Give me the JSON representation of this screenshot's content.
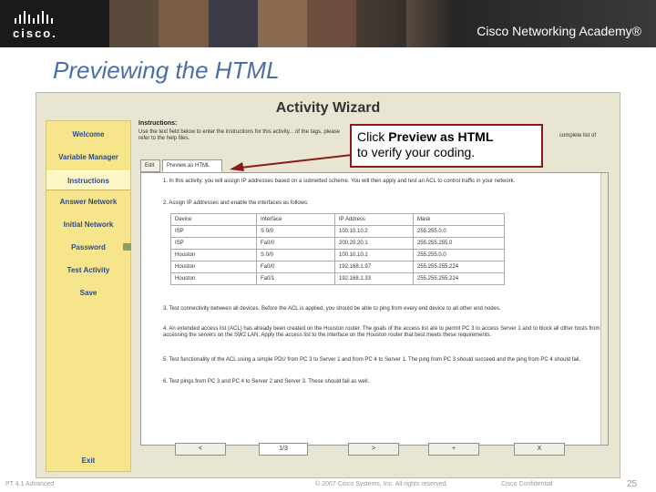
{
  "header": {
    "academy_text": "Cisco Networking Academy®",
    "logo_text": "cisco."
  },
  "slide": {
    "title": "Previewing the HTML"
  },
  "wizard": {
    "title": "Activity Wizard",
    "sidebar": [
      {
        "label": "Welcome"
      },
      {
        "label": "Variable Manager"
      },
      {
        "label": "Instructions"
      },
      {
        "label": "Answer Network"
      },
      {
        "label": "Initial Network"
      },
      {
        "label": "Password"
      },
      {
        "label": "Test Activity"
      },
      {
        "label": "Save"
      },
      {
        "label": "Exit"
      }
    ],
    "instructions_label": "Instructions:",
    "instructions_text": "Use the text field below to enter the instructions for this activity... of the tags, please refer to the help files.",
    "instructions_tail": "complete list of",
    "tabs": {
      "edit": "Edit",
      "preview": "Preview as HTML"
    },
    "preview": {
      "item1": "1. In this activity, you will assign IP addresses based on a subnetted scheme. You will then apply and test an ACL to control traffic in your network.",
      "item2": "2. Assign IP addresses and enable the interfaces as follows:",
      "item3": "3. Test connectivity between all devices. Before the ACL is applied, you should be able to ping from every end device to all other end nodes.",
      "item4": "4. An extended access list (ACL) has already been created on the Houston router. The goals of the access list are to permit PC 3 to access Server 1 and to block all other hosts from accessing the servers on the SW2 LAN. Apply the access list to the interface on the Houston router that best meets these requirements.",
      "item5": "5. Test functionality of the ACL using a simple PDU from PC 3 to Server 1 and from PC 4 to Server 1. The ping from PC 3 should succeed and the ping from PC 4 should fail.",
      "item6": "6. Test pings from PC 3 and PC 4 to Server 2 and Server 3. These should fail as well.",
      "table_headers": [
        "Device",
        "Interface",
        "IP Address",
        "Mask"
      ],
      "table_rows": [
        [
          "ISP",
          "S 0/0",
          "100.10.10.2",
          "255.255.0.0"
        ],
        [
          "ISP",
          "Fa0/0",
          "200.20.20.1",
          "255.255.255.0"
        ],
        [
          "Houston",
          "S 0/0",
          "100.10.10.1",
          "255.255.0.0"
        ],
        [
          "Houston",
          "Fa0/0",
          "192.168.1.97",
          "255.255.255.224"
        ],
        [
          "Houston",
          "Fa0/1",
          "192.168.1.33",
          "255.255.255.224"
        ]
      ]
    },
    "footer": {
      "prev_label": "<",
      "page_label": "1/3",
      "next_label": ">",
      "add_label": "+",
      "delete_label": "X"
    }
  },
  "callout": {
    "prefix": "Click ",
    "emphasis": "Preview as HTML",
    "suffix": "to verify your coding."
  },
  "slide_footer": {
    "left": "PT 4.1 Advanced",
    "center": "© 2007 Cisco Systems, Inc. All rights reserved.",
    "right_confidential": "Cisco Confidential",
    "page_number": "25"
  },
  "colors": {
    "title": "#4a6fa5",
    "sidebar_bg": "#f7e58c",
    "callout_border": "#8b1a1a",
    "wizard_bg": "#e8e5d2"
  }
}
